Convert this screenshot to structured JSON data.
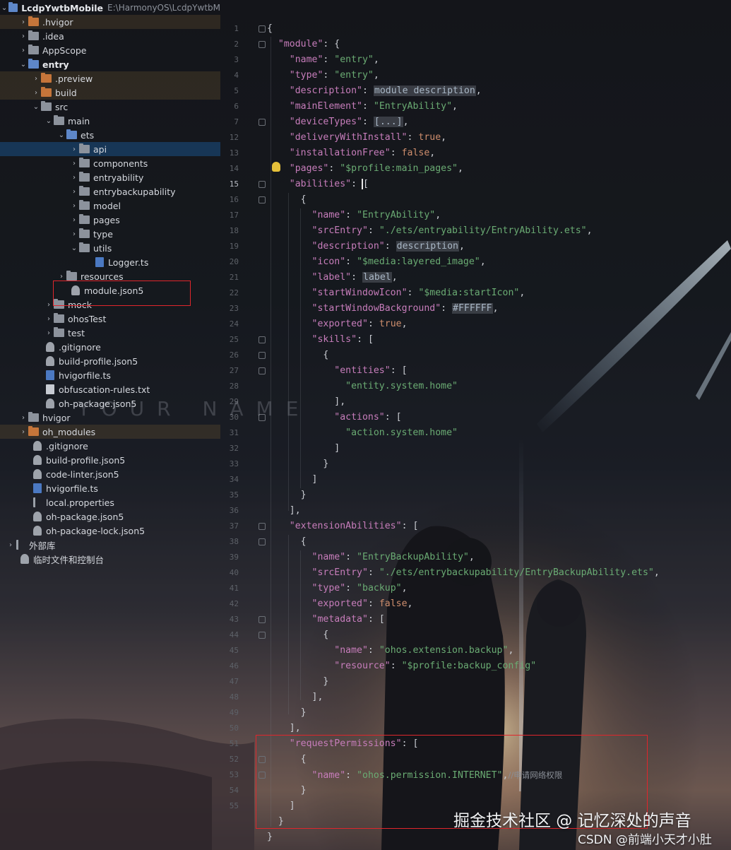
{
  "project": {
    "name": "LcdpYwtbMobile",
    "path": "E:\\HarmonyOS\\LcdpYwtbM",
    "items": [
      {
        "label": ".hvigor"
      },
      {
        "label": ".idea"
      },
      {
        "label": "AppScope"
      },
      {
        "label": "entry"
      },
      {
        "label": ".preview"
      },
      {
        "label": "build"
      },
      {
        "label": "src"
      },
      {
        "label": "main"
      },
      {
        "label": "ets"
      },
      {
        "label": "api"
      },
      {
        "label": "components"
      },
      {
        "label": "entryability"
      },
      {
        "label": "entrybackupability"
      },
      {
        "label": "model"
      },
      {
        "label": "pages"
      },
      {
        "label": "type"
      },
      {
        "label": "utils"
      },
      {
        "label": "Logger.ts"
      },
      {
        "label": "resources"
      },
      {
        "label": "module.json5"
      },
      {
        "label": "mock"
      },
      {
        "label": "ohosTest"
      },
      {
        "label": "test"
      },
      {
        "label": ".gitignore"
      },
      {
        "label": "build-profile.json5"
      },
      {
        "label": "hvigorfile.ts"
      },
      {
        "label": "obfuscation-rules.txt"
      },
      {
        "label": "oh-package.json5"
      },
      {
        "label": "hvigor"
      },
      {
        "label": "oh_modules"
      },
      {
        "label": ".gitignore"
      },
      {
        "label": "build-profile.json5"
      },
      {
        "label": "code-linter.json5"
      },
      {
        "label": "hvigorfile.ts"
      },
      {
        "label": "local.properties"
      },
      {
        "label": "oh-package.json5"
      },
      {
        "label": "oh-package-lock.json5"
      },
      {
        "label": "外部库"
      },
      {
        "label": "临时文件和控制台"
      }
    ]
  },
  "editor": {
    "line_numbers": [
      "1",
      "2",
      "3",
      "4",
      "5",
      "6",
      "7",
      "12",
      "13",
      "14",
      "15",
      "16",
      "17",
      "18",
      "19",
      "20",
      "21",
      "22",
      "23",
      "24",
      "25",
      "26",
      "27",
      "28",
      "29",
      "30",
      "31",
      "32",
      "33",
      "34",
      "35",
      "36",
      "37",
      "38",
      "39",
      "40",
      "41",
      "42",
      "43",
      "44",
      "45",
      "46",
      "47",
      "48",
      "49",
      "50",
      "51",
      "52",
      "53",
      "54",
      "55"
    ],
    "current_line": "15",
    "code": {
      "l1": "{",
      "l2": "\"module\"",
      "l3": "\"name\"",
      "l3v": "\"entry\"",
      "l4": "\"type\"",
      "l4v": "\"entry\"",
      "l5": "\"description\"",
      "l5v": "module description",
      "l6": "\"mainElement\"",
      "l6v": "\"EntryAbility\"",
      "l7": "\"deviceTypes\"",
      "l7v": "[...]",
      "l8": "\"deliveryWithInstall\"",
      "l8v": "true",
      "l9": "\"installationFree\"",
      "l9v": "false",
      "l10": "\"pages\"",
      "l10v": "\"$profile:main_pages\"",
      "l11": "\"abilities\"",
      "l13": "\"name\"",
      "l13v": "\"EntryAbility\"",
      "l14": "\"srcEntry\"",
      "l14v": "\"./ets/entryability/EntryAbility.ets\"",
      "l15": "\"description\"",
      "l15v": "description",
      "l16": "\"icon\"",
      "l16v": "\"$media:layered_image\"",
      "l17": "\"label\"",
      "l17v": "label",
      "l18": "\"startWindowIcon\"",
      "l18v": "\"$media:startIcon\"",
      "l19": "\"startWindowBackground\"",
      "l19v": "#FFFFFF",
      "l20": "\"exported\"",
      "l20v": "true",
      "l21": "\"skills\"",
      "l23": "\"entities\"",
      "l24v": "\"entity.system.home\"",
      "l26": "\"actions\"",
      "l27v": "\"action.system.home\"",
      "l33": "\"extensionAbilities\"",
      "l35": "\"name\"",
      "l35v": "\"EntryBackupAbility\"",
      "l36": "\"srcEntry\"",
      "l36v": "\"./ets/entrybackupability/EntryBackupAbility.ets\"",
      "l37": "\"type\"",
      "l37v": "\"backup\"",
      "l38": "\"exported\"",
      "l38v": "false",
      "l39": "\"metadata\"",
      "l41": "\"name\"",
      "l41v": "\"ohos.extension.backup\"",
      "l42": "\"resource\"",
      "l42v": "\"$profile:backup_config\"",
      "l48": "\"requestPermissions\"",
      "l50": "\"name\"",
      "l50v": "\"ohos.permission.INTERNET\"",
      "l50c": "//申请网络权限"
    }
  },
  "watermarks": {
    "name_art": "YOUR NAME",
    "juejin": "掘金技术社区 @ 记忆深处的声音",
    "csdn": "CSDN @前端小天才小肚"
  },
  "colors": {
    "selection": "#183c60",
    "highlight_box": "#e0262c",
    "string": "#6aab73",
    "key": "#c77dbb",
    "keyword": "#cf8e6d"
  }
}
